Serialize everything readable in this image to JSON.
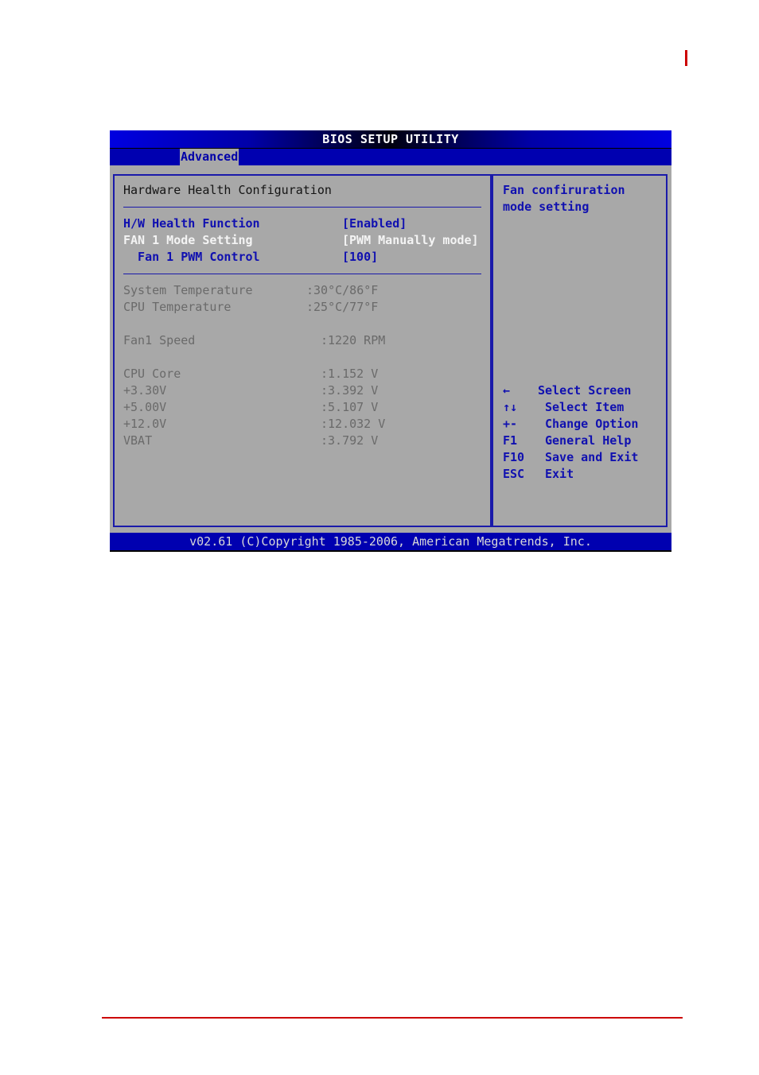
{
  "bios": {
    "title": "BIOS SETUP UTILITY",
    "active_tab": "Advanced",
    "section_title": "Hardware Health Configuration",
    "settings": [
      {
        "label": "H/W Health Function",
        "value": "[Enabled]",
        "state": "normal"
      },
      {
        "label": "FAN 1 Mode Setting",
        "value": "[PWM Manually mode]",
        "state": "selected"
      },
      {
        "label": "  Fan 1 PWM Control",
        "value": "[100]",
        "state": "normal"
      }
    ],
    "readings": {
      "temperatures": [
        {
          "label": "System Temperature",
          "value": ":30°C/86°F"
        },
        {
          "label": "CPU Temperature",
          "value": ":25°C/77°F"
        }
      ],
      "fans": [
        {
          "label": "Fan1 Speed",
          "value": ":1220 RPM"
        }
      ],
      "voltages": [
        {
          "label": "CPU Core",
          "value": ":1.152 V"
        },
        {
          "label": "+3.30V",
          "value": ":3.392 V"
        },
        {
          "label": "+5.00V",
          "value": ":5.107 V"
        },
        {
          "label": "+12.0V",
          "value": ":12.032 V"
        },
        {
          "label": "VBAT",
          "value": ":3.792 V"
        }
      ]
    },
    "help_text": [
      "Fan confiruration",
      "mode setting"
    ],
    "key_legend": [
      {
        "key": "←",
        "action": "Select Screen"
      },
      {
        "key": "↑↓",
        "action": "Select Item"
      },
      {
        "key": "+-",
        "action": "Change Option"
      },
      {
        "key": "F1",
        "action": "General Help"
      },
      {
        "key": "F10",
        "action": "Save and Exit"
      },
      {
        "key": "ESC",
        "action": "Exit"
      }
    ],
    "footer": "v02.61 (C)Copyright 1985-2006, American Megatrends, Inc."
  },
  "colors": {
    "accent_red": "#cc0000",
    "bios_blue": "#0000b0",
    "bios_gray": "#a8a8a8"
  }
}
